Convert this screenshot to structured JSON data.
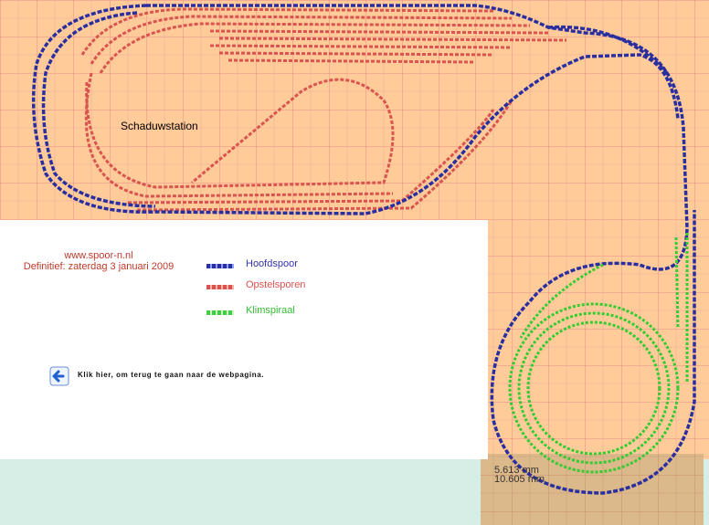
{
  "website": "www.spoor-n.nl",
  "definitief": "Definitief: zaterdag 3 januari 2009",
  "station_label": "Schaduwstation",
  "legend": [
    {
      "label": "Hoofdspoor",
      "color": "#3333aa"
    },
    {
      "label": "Opstelsporen",
      "color": "#d9534f"
    },
    {
      "label": "Klimspiraal",
      "color": "#44cc44"
    }
  ],
  "back_link": "Klik hier, om terug te gaan naar de webpagina.",
  "dimension_1": "5.613 mm",
  "dimension_2": "10.605 mm",
  "colors": {
    "board": "#ffcc99",
    "grid": "#e88a8a",
    "hoofdspoor": "#2a2fa0",
    "opstelsporen": "#d9534f",
    "klimspiraal": "#33cc33",
    "background": "#d6eee6"
  }
}
